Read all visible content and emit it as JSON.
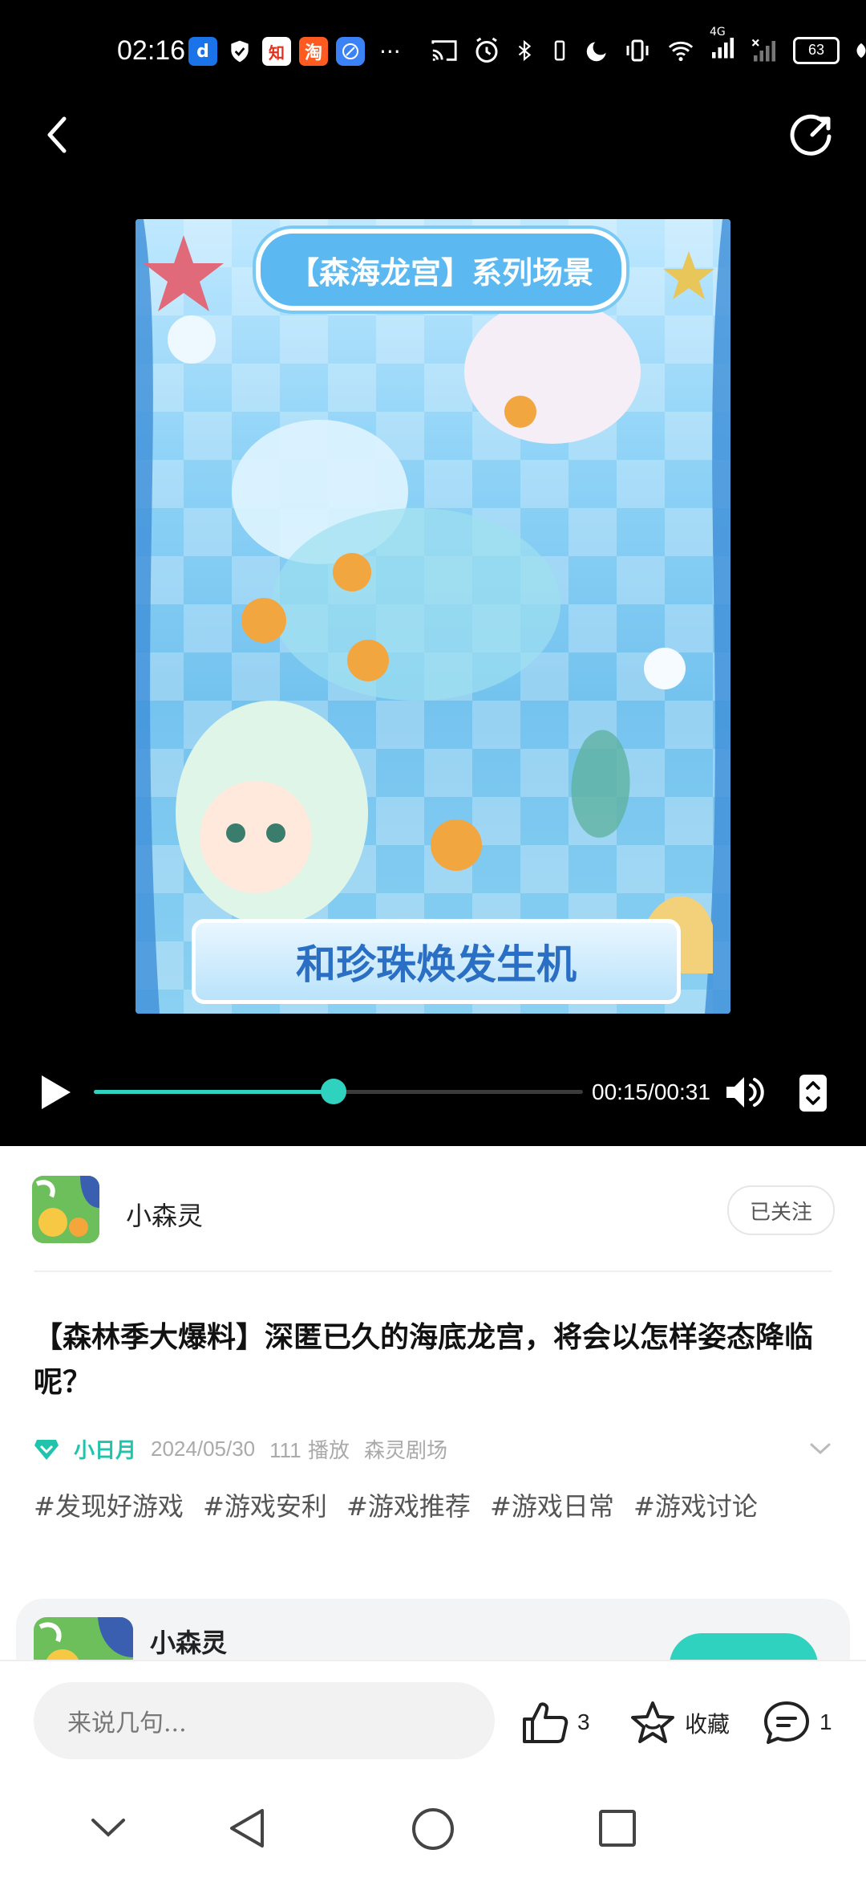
{
  "status_bar": {
    "time": "02:16",
    "battery": "63",
    "network": "4G",
    "more_indicator": "···",
    "left_app_icons": [
      "douyin-icon",
      "shield-icon",
      "zhihu-icon",
      "taobao-icon",
      "browser-icon"
    ]
  },
  "video": {
    "frame_title": "【森海龙宫】系列场景",
    "frame_caption": "和珍珠焕发生机",
    "current_time": "00:15",
    "duration": "00:31",
    "time_display": "00:15/00:31",
    "progress": 0.49
  },
  "author": {
    "name": "小森灵",
    "follow_label": "已关注"
  },
  "post": {
    "title": "【森林季大爆料】深匿已久的海底龙宫，将会以怎样姿态降临呢？",
    "meta_user": "小日月",
    "meta_date": "2024/05/30",
    "meta_plays_count": "111",
    "meta_plays_label": "播放",
    "meta_channel": "森灵剧场",
    "tags": [
      "#发现好游戏",
      "#游戏安利",
      "#游戏推荐",
      "#游戏日常",
      "#游戏讨论"
    ]
  },
  "card": {
    "name": "小森灵"
  },
  "bottom_bar": {
    "comment_placeholder": "来说几句...",
    "like_count": "3",
    "favorite_label": "收藏",
    "comment_count": "1"
  },
  "colors": {
    "accent": "#2fd2bf",
    "background_top": "#000000",
    "background_content": "#ffffff"
  }
}
